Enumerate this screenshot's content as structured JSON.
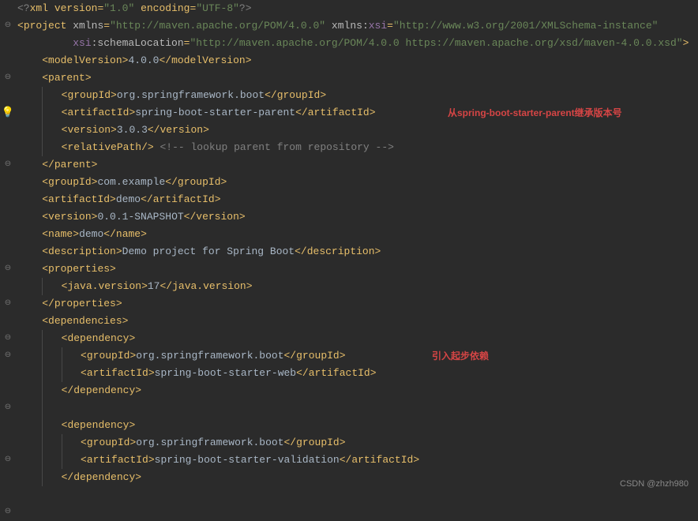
{
  "gutter": {
    "icons": [
      "",
      "⊖",
      "",
      "",
      "⊖",
      "",
      "",
      "💡",
      "",
      "",
      "⊖",
      "",
      "",
      "",
      "",
      "⊖",
      "",
      "⊖",
      "",
      "⊖",
      "⊖",
      "",
      "",
      "⊖",
      "",
      "",
      "",
      "⊖",
      "",
      "",
      ""
    ]
  },
  "code": {
    "prolog_open": "<?",
    "prolog_xml": "xml version",
    "prolog_ver": "\"1.0\"",
    "prolog_enc_k": "encoding",
    "prolog_enc_v": "\"UTF-8\"",
    "prolog_close": "?>",
    "project": "project",
    "xmlns": "xmlns",
    "xmlns_val": "\"http://maven.apache.org/POM/4.0.0\"",
    "xsi": "xsi",
    "xsi_val": "\"http://www.w3.org/2001/XMLSchema-instance\"",
    "schemaLoc_k": ":schemaLocation",
    "schemaLoc_v": "\"http://maven.apache.org/POM/4.0.0 https://maven.apache.org/xsd/maven-4.0.0.xsd\"",
    "modelVersion": "modelVersion",
    "modelVersion_v": "4.0.0",
    "parent": "parent",
    "groupId": "groupId",
    "groupId_v": "org.springframework.boot",
    "artifactId": "artifactId",
    "artifactId_v": "spring-boot-starter-parent",
    "version": "version",
    "version_v": "3.0.3",
    "relativePath": "relativePath",
    "parent_comment": "<!-- lookup parent from repository -->",
    "groupId2_v": "com.example",
    "artifactId2_v": "demo",
    "version2_v": "0.0.1-SNAPSHOT",
    "name": "name",
    "name_v": "demo",
    "description": "description",
    "description_v": "Demo project for Spring Boot",
    "properties": "properties",
    "javaVersion": "java.version",
    "javaVersion_v": "17",
    "dependencies": "dependencies",
    "dependency": "dependency",
    "dep1_artifact": "spring-boot-starter-web",
    "dep2_artifact": "spring-boot-starter-validation"
  },
  "annotations": {
    "a1": "从spring-boot-starter-parent继承版本号",
    "a2": "引入起步依赖"
  },
  "watermark": "CSDN @zhzh980"
}
